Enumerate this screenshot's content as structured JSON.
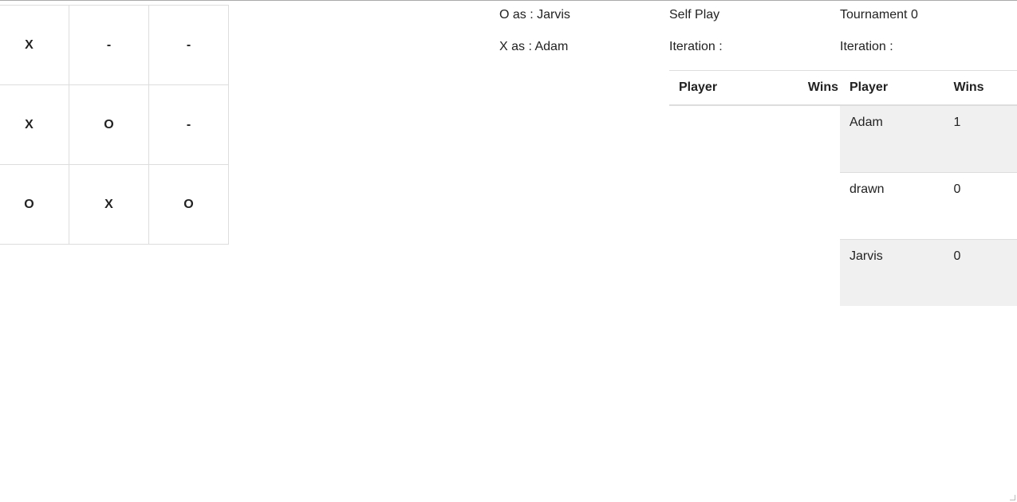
{
  "board": [
    [
      "X",
      "-",
      "-"
    ],
    [
      "X",
      "O",
      "-"
    ],
    [
      "O",
      "X",
      "O"
    ]
  ],
  "players": {
    "o_label": "O as : Jarvis",
    "x_label": "X as : Adam"
  },
  "self_play": {
    "title": "Self Play",
    "iteration_label": "Iteration :",
    "headers": {
      "player": "Player",
      "wins": "Wins"
    }
  },
  "tournament": {
    "title": "Tournament 0",
    "iteration_label": "Iteration :",
    "headers": {
      "player": "Player",
      "wins": "Wins"
    },
    "rows": [
      {
        "player": "Adam",
        "wins": "1"
      },
      {
        "player": "drawn",
        "wins": "0"
      },
      {
        "player": "Jarvis",
        "wins": "0"
      }
    ]
  }
}
